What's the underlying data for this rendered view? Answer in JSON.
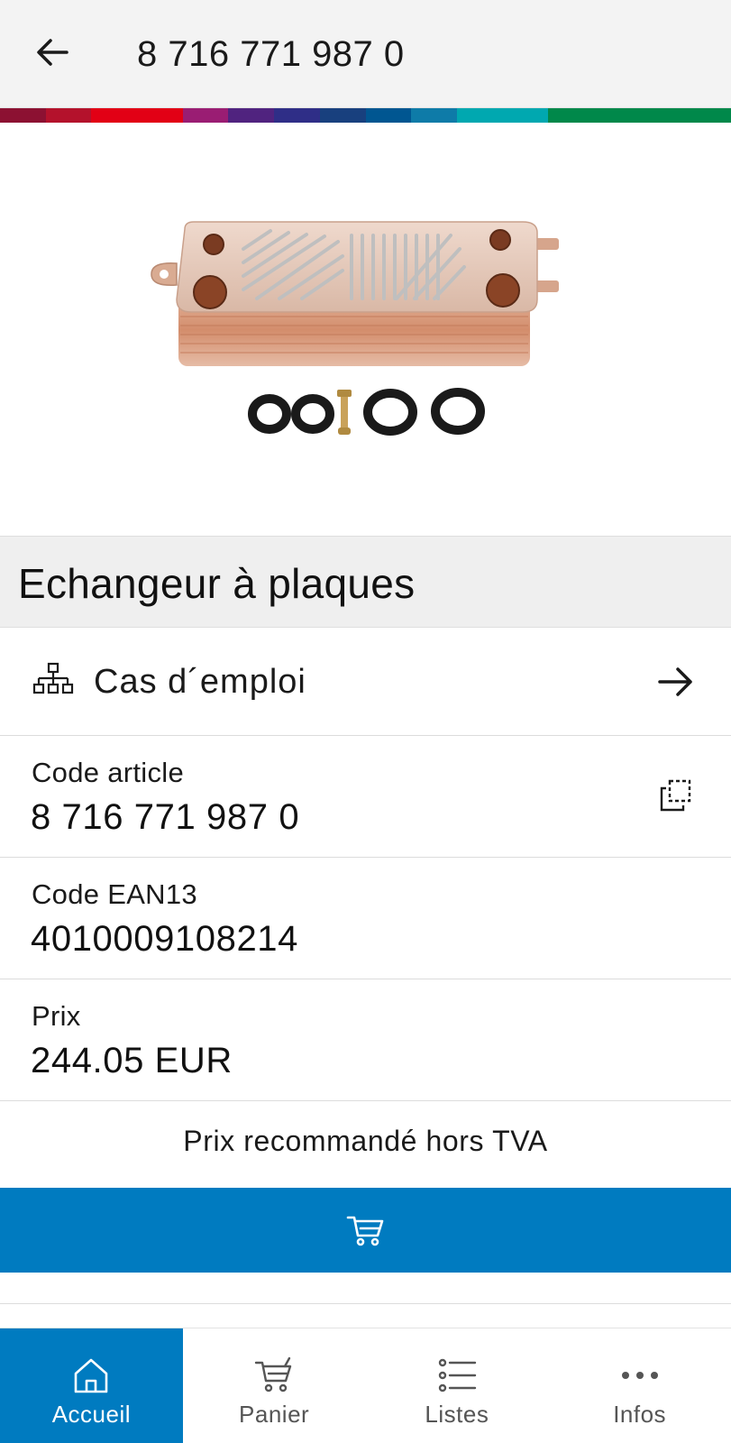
{
  "header": {
    "title": "8 716 771 987 0",
    "back_icon": "arrow-left-icon"
  },
  "supergraphic_colors": [
    "#8c1132",
    "#b4122c",
    "#e20015",
    "#e20015",
    "#9a1d73",
    "#50237f",
    "#2f2e87",
    "#18407e",
    "#005691",
    "#0e7ba8",
    "#00a8b0",
    "#00a8b0",
    "#00884a",
    "#00884a",
    "#00884a",
    "#00884a"
  ],
  "product": {
    "name": "Echangeur à plaques"
  },
  "where_used": {
    "label": "Cas d´emploi",
    "icon": "hierarchy-icon",
    "arrow_icon": "arrow-right-icon"
  },
  "fields": {
    "code": {
      "label": "Code article",
      "value": "8 716 771 987 0",
      "copy_icon": "copy-icon"
    },
    "ean": {
      "label": "Code EAN13",
      "value": "4010009108214"
    },
    "price": {
      "label": "Prix",
      "value": "244.05 EUR"
    }
  },
  "price_note": "Prix recommandé hors TVA",
  "cart_button": {
    "icon": "cart-icon",
    "color": "#007bc0"
  },
  "tabs": [
    {
      "label": "Accueil",
      "icon": "home-icon",
      "active": true
    },
    {
      "label": "Panier",
      "icon": "cart-icon",
      "active": false
    },
    {
      "label": "Listes",
      "icon": "list-icon",
      "active": false
    },
    {
      "label": "Infos",
      "icon": "more-icon",
      "active": false
    }
  ],
  "colors": {
    "accent": "#007bc0",
    "header_bg": "#f3f3f3",
    "name_bar_bg": "#efefef"
  }
}
